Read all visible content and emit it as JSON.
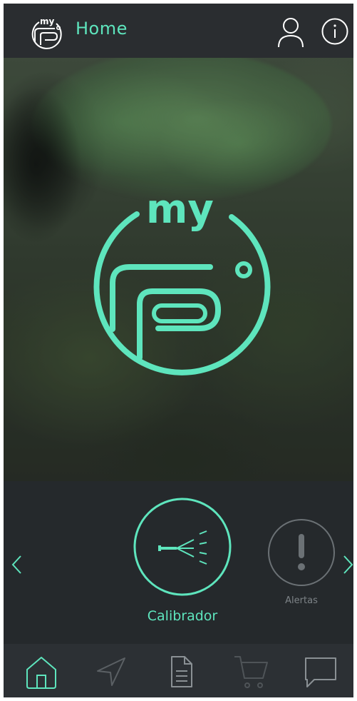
{
  "header": {
    "title": "Home",
    "logo_text": "my",
    "icons": [
      "logo-icon",
      "user-icon",
      "info-icon"
    ]
  },
  "hero": {
    "logo_text": "my"
  },
  "carousel": {
    "items": [
      {
        "label": "Calibrador",
        "icon": "sprayer-icon",
        "active": true
      },
      {
        "label": "Alertas",
        "icon": "alert-icon",
        "active": false
      }
    ]
  },
  "tabbar": {
    "items": [
      {
        "icon": "home-icon",
        "active": true
      },
      {
        "icon": "navigation-icon",
        "active": false
      },
      {
        "icon": "document-icon",
        "active": false
      },
      {
        "icon": "cart-icon",
        "active": false
      },
      {
        "icon": "chat-icon",
        "active": false
      }
    ]
  },
  "colors": {
    "accent": "#5ee5bd",
    "inactive": "#7d8387",
    "background": "#232629"
  }
}
